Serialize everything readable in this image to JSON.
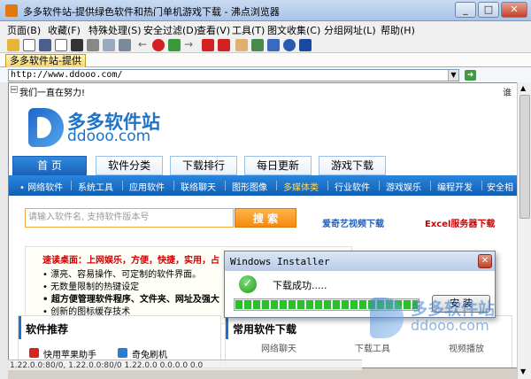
{
  "window": {
    "title": "多多软件站-提供绿色软件和热门单机游戏下载 - 沸点浏览器",
    "min_glyph": "_",
    "max_glyph": "□",
    "close_glyph": "✕"
  },
  "menu": [
    "页面(B)",
    "收藏(F)",
    "特殊处理(S)",
    "安全过滤(D)",
    "查看(V)",
    "工具(T)",
    "图文收集(C)",
    "分组网址(L)",
    "帮助(H)"
  ],
  "toolbar_icons": [
    "open-folder-icon",
    "new-page-icon",
    "save-icon",
    "copy-icon",
    "binoculars-icon",
    "print-icon",
    "properties-icon",
    "settings-icon",
    "back-icon",
    "stop-icon",
    "refresh-icon",
    "forward-icon",
    "close-page-icon",
    "close-all-icon",
    "hand-icon",
    "image-icon",
    "mail-icon",
    "help-icon",
    "info-icon"
  ],
  "tab": {
    "label": "多多软件站-提供"
  },
  "address": {
    "url": "http://www.ddooo.com/",
    "go_glyph": "➜",
    "drop_glyph": "▼"
  },
  "page": {
    "notice": "我们一直在努力!",
    "notice_glyph": "⇨",
    "top_right": "谁",
    "logo": {
      "cn": "多多软件站",
      "en": "ddooo.com"
    },
    "nav_tabs": [
      "首 页",
      "软件分类",
      "下载排行",
      "每日更新",
      "游戏下载"
    ],
    "sub_nav": [
      "网络软件",
      "系统工具",
      "应用软件",
      "联络聊天",
      "图形图像",
      "多媒体类",
      "行业软件",
      "游戏娱乐",
      "编程开发",
      "安全相关"
    ],
    "search": {
      "placeholder": "请输入软件名, 支持软件版本号",
      "button": "搜 索"
    },
    "promo": [
      "爱奇艺视频下载",
      "Excel服务器下载"
    ],
    "features": {
      "headline": "速读桌面：上网娱乐，方便，快捷，实用，占",
      "lines": [
        "• 漂亮、容易操作、可定制的软件界面。",
        "• 无数量限制的热键设定",
        "• 超方便管理软件程序、文件夹、网址及强大",
        "• 创新的图标缓存技术"
      ]
    },
    "left_section": {
      "title": "软件推荐",
      "apps": [
        {
          "label": "快用苹果助手",
          "icon": "kuaiyong-icon",
          "color": "#d8261c"
        },
        {
          "label": "奇兔刷机",
          "icon": "qitu-icon",
          "color": "#2b7bd6"
        }
      ]
    },
    "right_section": {
      "title": "常用软件下载",
      "cols": [
        "网络聊天",
        "下载工具",
        "视频播放"
      ]
    },
    "status": "1.22.0.0:80/0, 1.22.0.0:80/0 1.22.0.0 0.0.0.0 0.0"
  },
  "dialog": {
    "title": "Windows Installer",
    "message": "下载成功.....",
    "button": "安 装",
    "check_glyph": "✓",
    "close_glyph": "✕",
    "progress": 1.0
  },
  "watermark": {
    "cn": "多多软件站",
    "en": "ddooo.com"
  },
  "colors": {
    "accent": "#1d73c8",
    "nav_blue": "#1a62b8",
    "search_orange": "#f48a0e",
    "promo_red": "#d00000",
    "success_green": "#2cbf2c"
  }
}
